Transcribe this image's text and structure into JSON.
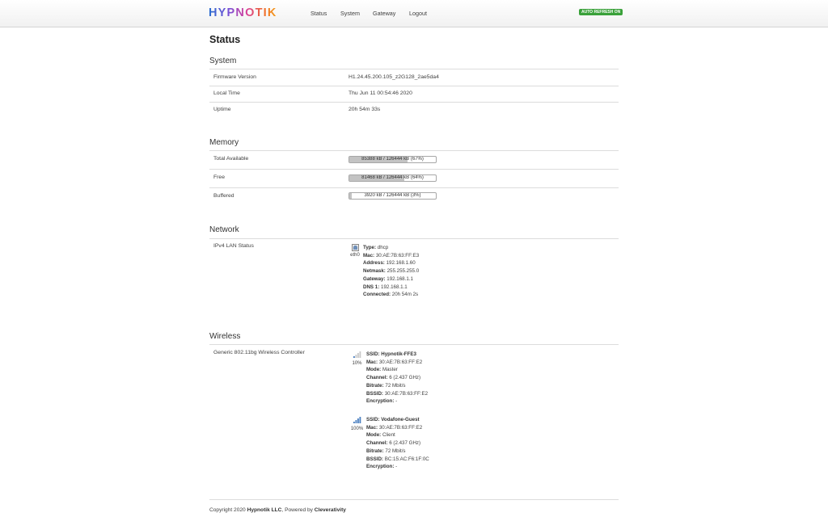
{
  "header": {
    "logo": "HYPNOTIK",
    "nav": [
      "Status",
      "System",
      "Gateway",
      "Logout"
    ],
    "badge": "AUTO REFRESH ON"
  },
  "page": {
    "title": "Status"
  },
  "system": {
    "title": "System",
    "rows": [
      {
        "label": "Firmware Version",
        "value": "H1.24.45.200.105_z2G128_2ae5da4"
      },
      {
        "label": "Local Time",
        "value": "Thu Jun 11 00:54:46 2020"
      },
      {
        "label": "Uptime",
        "value": "20h 54m 33s"
      }
    ]
  },
  "memory": {
    "title": "Memory",
    "rows": [
      {
        "label": "Total Available",
        "text": "85388 kB / 126444 kB (67%)",
        "percent": 67
      },
      {
        "label": "Free",
        "text": "81468 kB / 126444 kB (64%)",
        "percent": 64
      },
      {
        "label": "Buffered",
        "text": "3920 kB / 126444 kB (3%)",
        "percent": 3
      }
    ]
  },
  "network": {
    "title": "Network",
    "label": "IPv4 LAN Status",
    "interface": {
      "name": "eth0",
      "icon": "ethernet-port-icon"
    },
    "fields": [
      {
        "key": "Type:",
        "value": "dhcp"
      },
      {
        "key": "Mac:",
        "value": "30:AE:7B:63:FF:E3"
      },
      {
        "key": "Address:",
        "value": "192.168.1.60"
      },
      {
        "key": "Netmask:",
        "value": "255.255.255.0"
      },
      {
        "key": "Gateway:",
        "value": "192.168.1.1"
      },
      {
        "key": "DNS 1:",
        "value": "192.168.1.1"
      },
      {
        "key": "Connected:",
        "value": "20h 54m 2s"
      }
    ]
  },
  "wireless": {
    "title": "Wireless",
    "label": "Generic 802.11bg Wireless Controller",
    "networks": [
      {
        "signal": "10%",
        "signal_fraction": 0.1,
        "icon": "signal-low-icon",
        "fields": [
          {
            "key": "SSID:",
            "value": "Hypnotik-FFE3"
          },
          {
            "key": "Mac:",
            "value": "30:AE:7B:63:FF:E2"
          },
          {
            "key": "Mode:",
            "value": "Master"
          },
          {
            "key": "Channel:",
            "value": "6 (2.437 GHz)"
          },
          {
            "key": "Bitrate:",
            "value": "72 Mbit/s"
          },
          {
            "key": "BSSID:",
            "value": "30:AE:7B:63:FF:E2"
          },
          {
            "key": "Encryption:",
            "value": "-"
          }
        ]
      },
      {
        "signal": "100%",
        "signal_fraction": 1.0,
        "icon": "signal-full-icon",
        "fields": [
          {
            "key": "SSID:",
            "value": "Vodafone-Guest"
          },
          {
            "key": "Mac:",
            "value": "30:AE:7B:63:FF:E2"
          },
          {
            "key": "Mode:",
            "value": "Client"
          },
          {
            "key": "Channel:",
            "value": "6 (2.437 GHz)"
          },
          {
            "key": "Bitrate:",
            "value": "72 Mbit/s"
          },
          {
            "key": "BSSID:",
            "value": "BC:15:AC:F6:1F:0C"
          },
          {
            "key": "Encryption:",
            "value": "-"
          }
        ]
      }
    ]
  },
  "footer": {
    "prefix": "Copyright 2020 ",
    "company": "Hypnotik LLC",
    "middle": ", Powered by ",
    "powered": "Cleverativity"
  },
  "colors": {
    "badge": "#3aa13a",
    "bar_fill": "#c3c3c3",
    "signal_active": "#4a7fc0",
    "signal_inactive": "#c8c8c8"
  }
}
